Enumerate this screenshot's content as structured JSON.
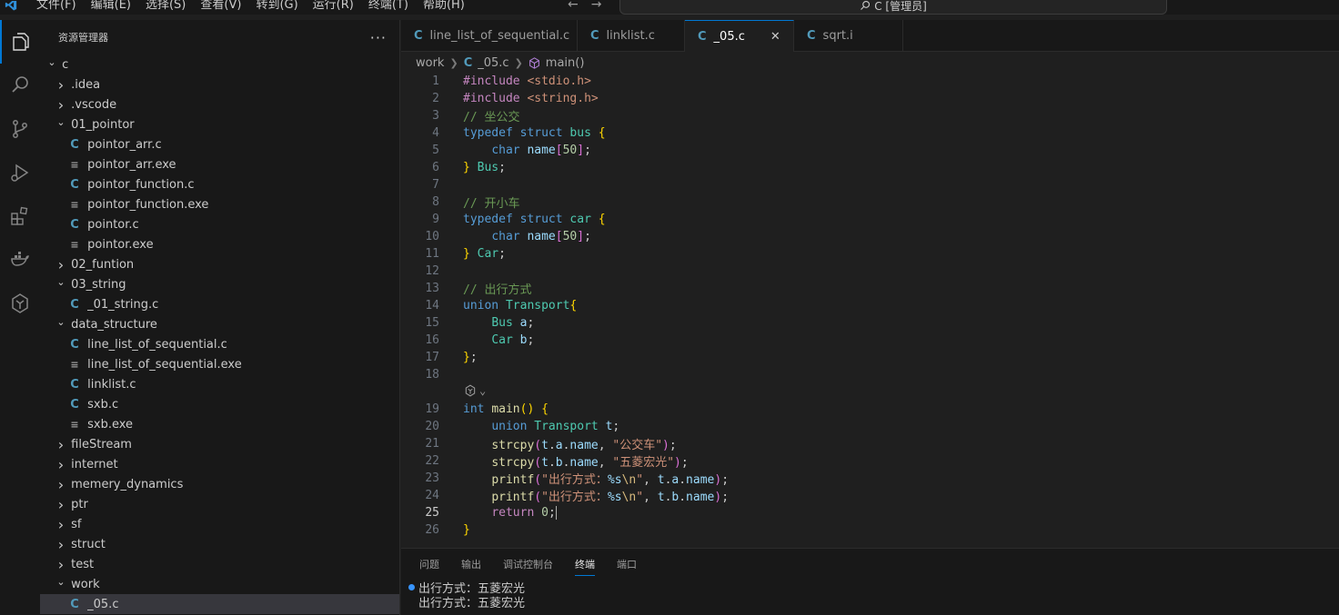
{
  "titlebar": {
    "menu": [
      "文件(F)",
      "编辑(E)",
      "选择(S)",
      "查看(V)",
      "转到(G)",
      "运行(R)",
      "终端(T)",
      "帮助(H)"
    ],
    "search_text": "C [管理员]"
  },
  "sidebar": {
    "title": "资源管理器",
    "more": "···",
    "tree": [
      {
        "label": "c",
        "kind": "folder",
        "open": true,
        "depth": 0
      },
      {
        "label": ".idea",
        "kind": "folder",
        "open": false,
        "depth": 1
      },
      {
        "label": ".vscode",
        "kind": "folder",
        "open": false,
        "depth": 1
      },
      {
        "label": "01_pointor",
        "kind": "folder",
        "open": true,
        "depth": 1
      },
      {
        "label": "pointor_arr.c",
        "kind": "c",
        "depth": 2
      },
      {
        "label": "pointor_arr.exe",
        "kind": "exe",
        "depth": 2
      },
      {
        "label": "pointor_function.c",
        "kind": "c",
        "depth": 2
      },
      {
        "label": "pointor_function.exe",
        "kind": "exe",
        "depth": 2
      },
      {
        "label": "pointor.c",
        "kind": "c",
        "depth": 2
      },
      {
        "label": "pointor.exe",
        "kind": "exe",
        "depth": 2
      },
      {
        "label": "02_funtion",
        "kind": "folder",
        "open": false,
        "depth": 1
      },
      {
        "label": "03_string",
        "kind": "folder",
        "open": true,
        "depth": 1
      },
      {
        "label": "_01_string.c",
        "kind": "c",
        "depth": 2
      },
      {
        "label": "data_structure",
        "kind": "folder",
        "open": true,
        "depth": 1
      },
      {
        "label": "line_list_of_sequential.c",
        "kind": "c",
        "depth": 2
      },
      {
        "label": "line_list_of_sequential.exe",
        "kind": "exe",
        "depth": 2
      },
      {
        "label": "linklist.c",
        "kind": "c",
        "depth": 2
      },
      {
        "label": "sxb.c",
        "kind": "c",
        "depth": 2
      },
      {
        "label": "sxb.exe",
        "kind": "exe",
        "depth": 2
      },
      {
        "label": "fileStream",
        "kind": "folder",
        "open": false,
        "depth": 1
      },
      {
        "label": "internet",
        "kind": "folder",
        "open": false,
        "depth": 1
      },
      {
        "label": "memery_dynamics",
        "kind": "folder",
        "open": false,
        "depth": 1
      },
      {
        "label": "ptr",
        "kind": "folder",
        "open": false,
        "depth": 1
      },
      {
        "label": "sf",
        "kind": "folder",
        "open": false,
        "depth": 1
      },
      {
        "label": "struct",
        "kind": "folder",
        "open": false,
        "depth": 1
      },
      {
        "label": "test",
        "kind": "folder",
        "open": false,
        "depth": 1
      },
      {
        "label": "work",
        "kind": "folder",
        "open": true,
        "depth": 1
      },
      {
        "label": "_05.c",
        "kind": "c",
        "depth": 2,
        "selected": true
      }
    ]
  },
  "tabs": [
    {
      "label": "line_list_of_sequential.c",
      "active": false
    },
    {
      "label": "linklist.c",
      "active": false
    },
    {
      "label": "_05.c",
      "active": true
    },
    {
      "label": "sqrt.i",
      "active": false
    }
  ],
  "breadcrumb": {
    "folder": "work",
    "file": "_05.c",
    "symbol": "main()"
  },
  "editor": {
    "current_line": 25,
    "lines": [
      {
        "n": "1",
        "tokens": [
          [
            "pp",
            "#include"
          ],
          [
            "",
            ""
          ],
          [
            "str",
            " <stdio.h>"
          ]
        ]
      },
      {
        "n": "2",
        "tokens": [
          [
            "pp",
            "#include"
          ],
          [
            "str",
            " <string.h>"
          ]
        ]
      },
      {
        "n": "3",
        "tokens": [
          [
            "cm",
            "// 坐公交"
          ]
        ]
      },
      {
        "n": "4",
        "tokens": [
          [
            "kw",
            "typedef"
          ],
          [
            "",
            " "
          ],
          [
            "kw",
            "struct"
          ],
          [
            "",
            " "
          ],
          [
            "ty",
            "bus"
          ],
          [
            "",
            " "
          ],
          [
            "br1",
            "{"
          ]
        ]
      },
      {
        "n": "5",
        "tokens": [
          [
            "",
            "    "
          ],
          [
            "kw",
            "char"
          ],
          [
            "",
            " "
          ],
          [
            "var",
            "name"
          ],
          [
            "br2",
            "["
          ],
          [
            "num",
            "50"
          ],
          [
            "br2",
            "]"
          ],
          [
            "",
            ";"
          ]
        ]
      },
      {
        "n": "6",
        "tokens": [
          [
            "br1",
            "}"
          ],
          [
            "",
            " "
          ],
          [
            "ty",
            "Bus"
          ],
          [
            "",
            ";"
          ]
        ]
      },
      {
        "n": "7",
        "tokens": []
      },
      {
        "n": "8",
        "tokens": [
          [
            "cm",
            "// 开小车"
          ]
        ]
      },
      {
        "n": "9",
        "tokens": [
          [
            "kw",
            "typedef"
          ],
          [
            "",
            " "
          ],
          [
            "kw",
            "struct"
          ],
          [
            "",
            " "
          ],
          [
            "ty",
            "car"
          ],
          [
            "",
            " "
          ],
          [
            "br1",
            "{"
          ]
        ]
      },
      {
        "n": "10",
        "tokens": [
          [
            "",
            "    "
          ],
          [
            "kw",
            "char"
          ],
          [
            "",
            " "
          ],
          [
            "var",
            "name"
          ],
          [
            "br2",
            "["
          ],
          [
            "num",
            "50"
          ],
          [
            "br2",
            "]"
          ],
          [
            "",
            ";"
          ]
        ]
      },
      {
        "n": "11",
        "tokens": [
          [
            "br1",
            "}"
          ],
          [
            "",
            " "
          ],
          [
            "ty",
            "Car"
          ],
          [
            "",
            ";"
          ]
        ]
      },
      {
        "n": "12",
        "tokens": []
      },
      {
        "n": "13",
        "tokens": [
          [
            "cm",
            "// 出行方式"
          ]
        ]
      },
      {
        "n": "14",
        "tokens": [
          [
            "kw",
            "union"
          ],
          [
            "",
            " "
          ],
          [
            "ty",
            "Transport"
          ],
          [
            "br1",
            "{"
          ]
        ]
      },
      {
        "n": "15",
        "tokens": [
          [
            "",
            "    "
          ],
          [
            "ty",
            "Bus"
          ],
          [
            "",
            " "
          ],
          [
            "var",
            "a"
          ],
          [
            "",
            ";"
          ]
        ]
      },
      {
        "n": "16",
        "tokens": [
          [
            "",
            "    "
          ],
          [
            "ty",
            "Car"
          ],
          [
            "",
            " "
          ],
          [
            "var",
            "b"
          ],
          [
            "",
            ";"
          ]
        ]
      },
      {
        "n": "17",
        "tokens": [
          [
            "br1",
            "}"
          ],
          [
            "",
            ";"
          ]
        ]
      },
      {
        "n": "18",
        "tokens": []
      },
      {
        "n": "19",
        "tokens": [
          [
            "kw",
            "int"
          ],
          [
            "",
            " "
          ],
          [
            "fn",
            "main"
          ],
          [
            "br1",
            "()"
          ],
          [
            "",
            " "
          ],
          [
            "br1",
            "{"
          ]
        ]
      },
      {
        "n": "20",
        "tokens": [
          [
            "",
            "    "
          ],
          [
            "kw",
            "union"
          ],
          [
            "",
            " "
          ],
          [
            "ty",
            "Transport"
          ],
          [
            "",
            " "
          ],
          [
            "var",
            "t"
          ],
          [
            "",
            ";"
          ]
        ]
      },
      {
        "n": "21",
        "tokens": [
          [
            "",
            "    "
          ],
          [
            "fn",
            "strcpy"
          ],
          [
            "br2",
            "("
          ],
          [
            "var",
            "t"
          ],
          [
            "",
            "."
          ],
          [
            "var",
            "a"
          ],
          [
            "",
            "."
          ],
          [
            "var",
            "name"
          ],
          [
            "",
            ", "
          ],
          [
            "str",
            "\"公交车\""
          ],
          [
            "br2",
            ")"
          ],
          [
            "",
            ";"
          ]
        ]
      },
      {
        "n": "22",
        "tokens": [
          [
            "",
            "    "
          ],
          [
            "fn",
            "strcpy"
          ],
          [
            "br2",
            "("
          ],
          [
            "var",
            "t"
          ],
          [
            "",
            "."
          ],
          [
            "var",
            "b"
          ],
          [
            "",
            "."
          ],
          [
            "var",
            "name"
          ],
          [
            "",
            ", "
          ],
          [
            "str",
            "\"五菱宏光\""
          ],
          [
            "br2",
            ")"
          ],
          [
            "",
            ";"
          ]
        ]
      },
      {
        "n": "23",
        "tokens": [
          [
            "",
            "    "
          ],
          [
            "fn",
            "printf"
          ],
          [
            "br2",
            "("
          ],
          [
            "str",
            "\"出行方式："
          ],
          [
            "var",
            "%s"
          ],
          [
            "esc",
            "\\n"
          ],
          [
            "str",
            "\""
          ],
          [
            "",
            ", "
          ],
          [
            "var",
            "t"
          ],
          [
            "",
            "."
          ],
          [
            "var",
            "a"
          ],
          [
            "",
            "."
          ],
          [
            "var",
            "name"
          ],
          [
            "br2",
            ")"
          ],
          [
            "",
            ";"
          ]
        ]
      },
      {
        "n": "24",
        "tokens": [
          [
            "",
            "    "
          ],
          [
            "fn",
            "printf"
          ],
          [
            "br2",
            "("
          ],
          [
            "str",
            "\"出行方式："
          ],
          [
            "var",
            "%s"
          ],
          [
            "esc",
            "\\n"
          ],
          [
            "str",
            "\""
          ],
          [
            "",
            ", "
          ],
          [
            "var",
            "t"
          ],
          [
            "",
            "."
          ],
          [
            "var",
            "b"
          ],
          [
            "",
            "."
          ],
          [
            "var",
            "name"
          ],
          [
            "br2",
            ")"
          ],
          [
            "",
            ";"
          ]
        ]
      },
      {
        "n": "25",
        "tokens": [
          [
            "",
            "    "
          ],
          [
            "pp",
            "return"
          ],
          [
            "",
            " "
          ],
          [
            "num",
            "0"
          ],
          [
            "",
            ";"
          ]
        ],
        "cursor": true
      },
      {
        "n": "26",
        "tokens": [
          [
            "br1",
            "}"
          ]
        ]
      }
    ]
  },
  "panel": {
    "tabs": [
      {
        "label": "问题",
        "active": false
      },
      {
        "label": "输出",
        "active": false
      },
      {
        "label": "调试控制台",
        "active": false
      },
      {
        "label": "终端",
        "active": true
      },
      {
        "label": "端口",
        "active": false
      }
    ],
    "terminal": [
      "出行方式：五菱宏光",
      "出行方式：五菱宏光"
    ]
  }
}
